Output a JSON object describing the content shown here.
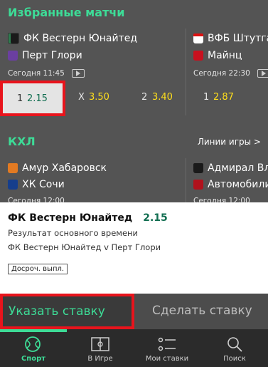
{
  "favorites": {
    "title": "Избранные матчи",
    "match1": {
      "home": "ФК Вестерн Юнайтед",
      "away": "Перт Глори",
      "time": "Сегодня 11:45",
      "odd1_label": "1",
      "odd1": "2.15",
      "oddx_label": "X",
      "oddx": "3.50",
      "odd2_label": "2",
      "odd2": "3.40"
    },
    "match2": {
      "home": "ВФБ Штутгарт",
      "away": "Майнц",
      "time": "Сегодня 22:30",
      "odd1_label": "1",
      "odd1": "2.87"
    }
  },
  "khl": {
    "title": "КХЛ",
    "lines_link": "Линии игры >",
    "match1": {
      "home": "Амур Хабаровск",
      "away": "ХК Сочи",
      "time": "Сегодня 12:00"
    },
    "match2": {
      "home": "Адмирал Вла",
      "away": "Автомобилис",
      "time": "Сегодня 12:00"
    }
  },
  "betslip": {
    "team": "ФК Вестерн Юнайтед",
    "odd": "2.15",
    "market": "Результат основного времени",
    "event": "ФК Вестерн Юнайтед v Перт Глори",
    "cashout_badge": "Досроч. выпл.",
    "stake_input": "Указать ставку",
    "place_bet": "Сделать ставку"
  },
  "nav": {
    "sport": "Спорт",
    "inplay": "В Игре",
    "mybets": "Мои ставки",
    "search": "Поиск"
  },
  "colors": {
    "accent": "#3ddc97",
    "odds": "#ffdf1b",
    "highlight": "#e8141c",
    "background": "#545454"
  }
}
